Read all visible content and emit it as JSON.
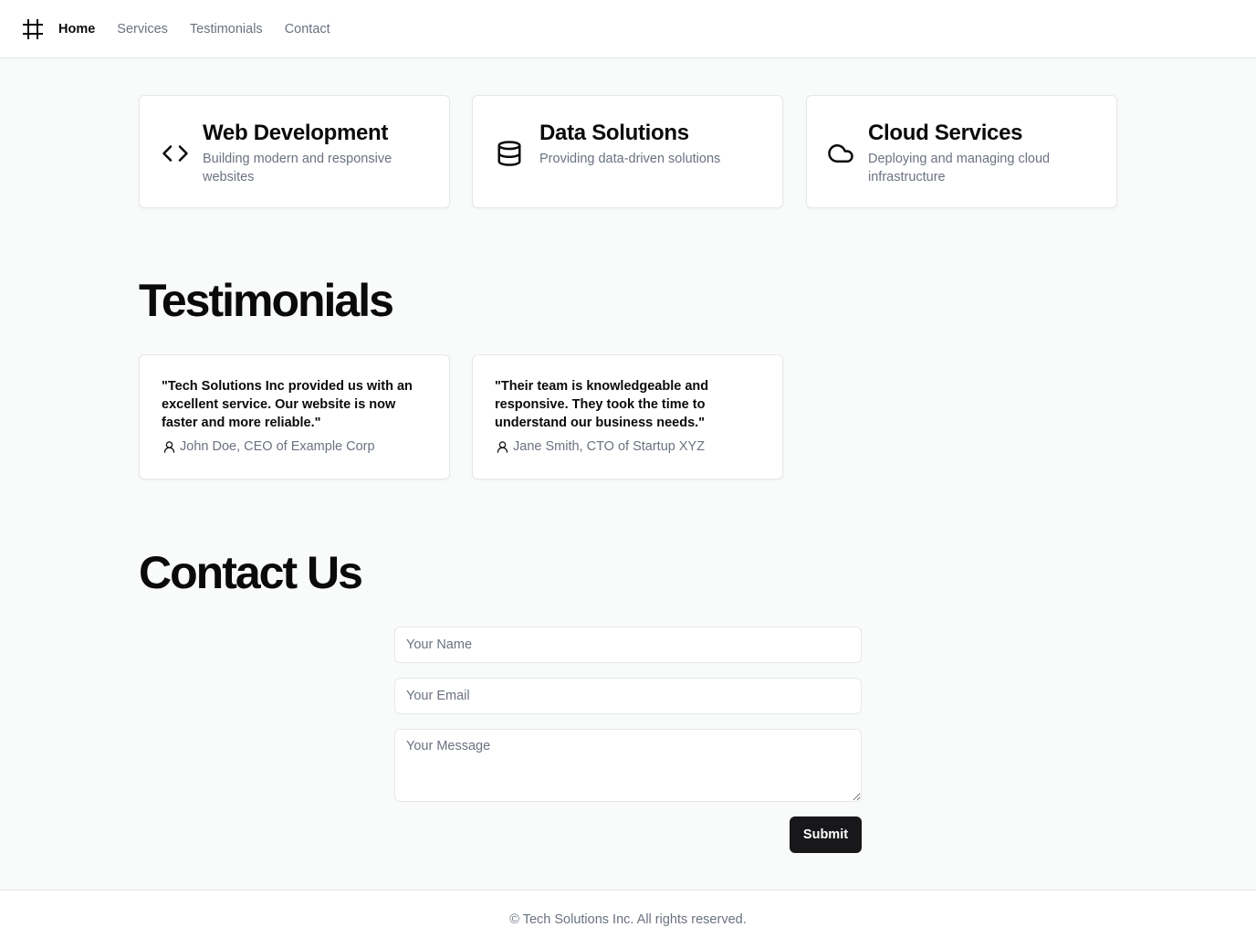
{
  "header": {
    "logo_icon": "hash-icon",
    "nav": [
      {
        "label": "Home",
        "active": true
      },
      {
        "label": "Services",
        "active": false
      },
      {
        "label": "Testimonials",
        "active": false
      },
      {
        "label": "Contact",
        "active": false
      }
    ]
  },
  "services": [
    {
      "icon": "code-icon",
      "title": "Web Development",
      "description": "Building modern and responsive websites"
    },
    {
      "icon": "database-icon",
      "title": "Data Solutions",
      "description": "Providing data-driven solutions"
    },
    {
      "icon": "cloud-icon",
      "title": "Cloud Services",
      "description": "Deploying and managing cloud infrastructure"
    }
  ],
  "testimonials": {
    "heading": "Testimonials",
    "items": [
      {
        "quote": "\"Tech Solutions Inc provided us with an excellent service. Our website is now faster and more reliable.\"",
        "author": "John Doe, CEO of Example Corp",
        "icon": "user-icon"
      },
      {
        "quote": "\"Their team is knowledgeable and responsive. They took the time to understand our business needs.\"",
        "author": "Jane Smith, CTO of Startup XYZ",
        "icon": "user-icon"
      }
    ]
  },
  "contact": {
    "heading": "Contact Us",
    "name_placeholder": "Your Name",
    "email_placeholder": "Your Email",
    "message_placeholder": "Your Message",
    "submit_label": "Submit"
  },
  "footer": {
    "text": "© Tech Solutions Inc. All rights reserved."
  },
  "colors": {
    "background": "#f9fafa",
    "card": "#ffffff",
    "muted_text": "#6b7280",
    "primary_button": "#18181b"
  }
}
